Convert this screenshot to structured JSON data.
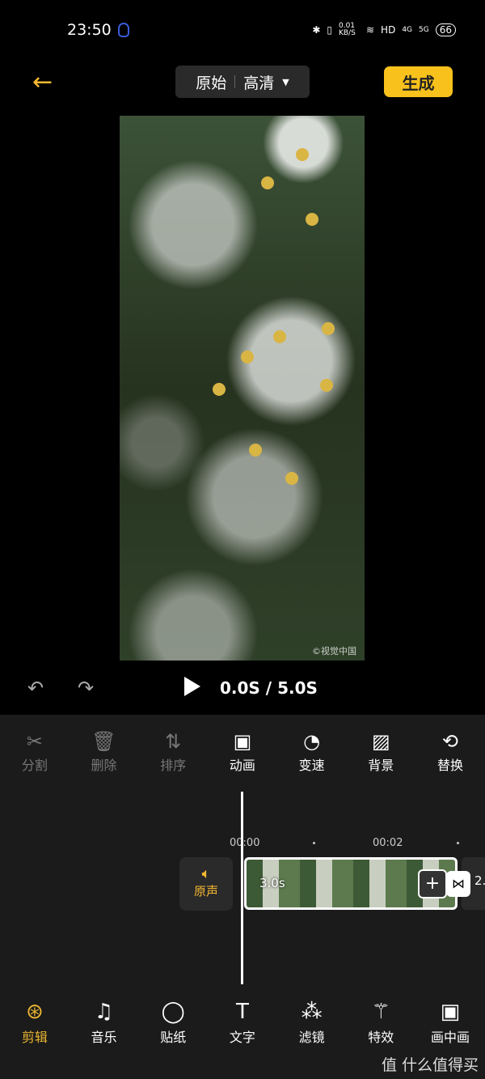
{
  "status_bar": {
    "time": "23:50",
    "net_speed": "0.01 KB/S",
    "hd": "HD",
    "sig1": "4G",
    "sig2": "5G",
    "battery": "66"
  },
  "header": {
    "back_icon": "arrow-left-icon",
    "quality_left": "原始",
    "quality_right": "高清",
    "generate": "生成"
  },
  "accent": "#f8c11c",
  "video": {
    "watermark": "©视觉中国"
  },
  "playback": {
    "time": "0.0S / 5.0S"
  },
  "tools": [
    {
      "label": "分割",
      "icon": "scissors-icon",
      "enabled": false
    },
    {
      "label": "删除",
      "icon": "trash-icon",
      "enabled": false
    },
    {
      "label": "排序",
      "icon": "sort-icon",
      "enabled": false
    },
    {
      "label": "动画",
      "icon": "animation-icon",
      "enabled": true
    },
    {
      "label": "变速",
      "icon": "speed-icon",
      "enabled": true
    },
    {
      "label": "背景",
      "icon": "background-icon",
      "enabled": true
    },
    {
      "label": "替换",
      "icon": "replace-icon",
      "enabled": true
    }
  ],
  "timeline": {
    "ticks": [
      "00:00",
      "00:02"
    ],
    "original_audio": "原声",
    "clip_duration": "3.0s",
    "next_clip": "2."
  },
  "nav": [
    {
      "label": "剪辑",
      "icon": "edit-reel-icon",
      "active": true
    },
    {
      "label": "音乐",
      "icon": "music-icon"
    },
    {
      "label": "贴纸",
      "icon": "sticker-icon"
    },
    {
      "label": "文字",
      "icon": "text-icon"
    },
    {
      "label": "滤镜",
      "icon": "filter-icon"
    },
    {
      "label": "特效",
      "icon": "magic-wand-icon"
    },
    {
      "label": "画中画",
      "icon": "pip-icon"
    }
  ],
  "brand_watermark": "值 什么值得买"
}
